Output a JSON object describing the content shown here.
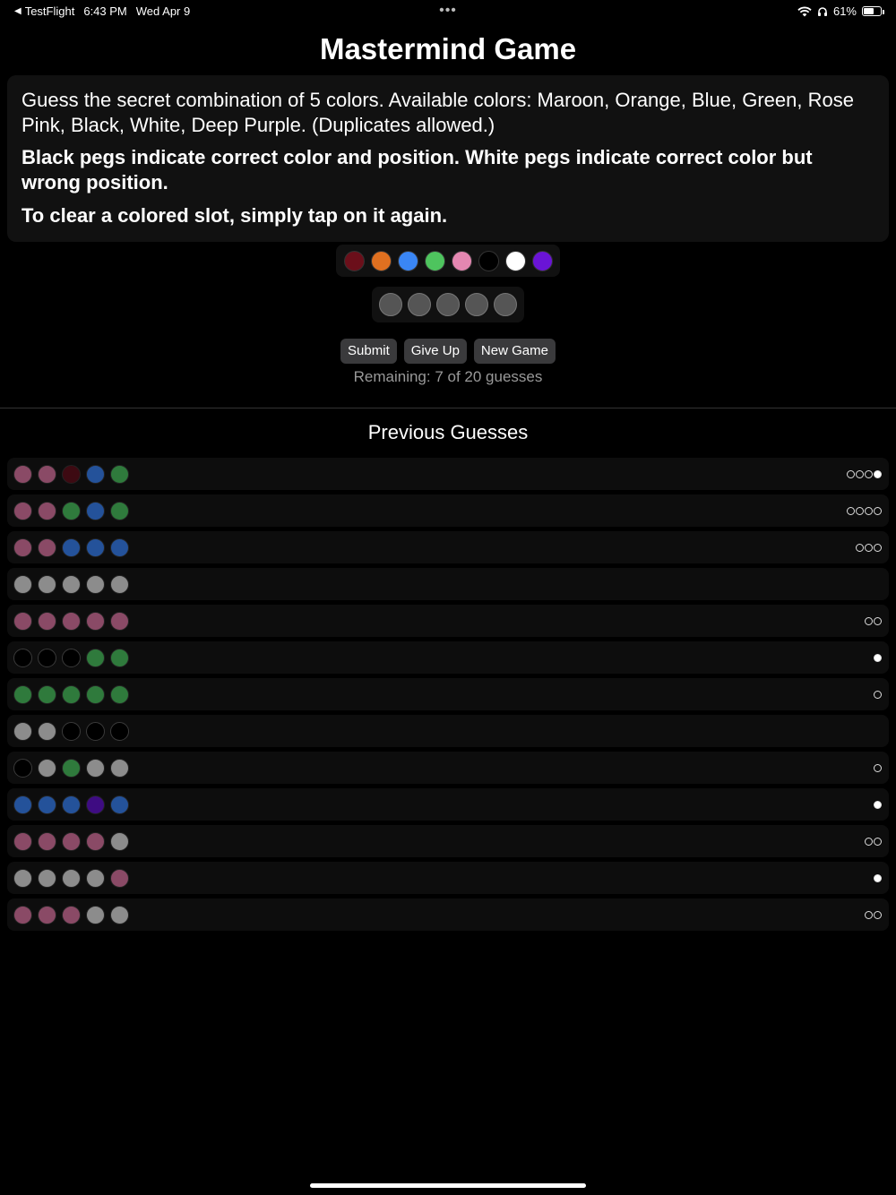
{
  "status_bar": {
    "back_app": "TestFlight",
    "time": "6:43 PM",
    "date": "Wed Apr 9",
    "more": "•••",
    "battery": "61%"
  },
  "title": "Mastermind Game",
  "instructions": {
    "line1": "Guess the secret combination of 5 colors. Available colors: Maroon, Orange, Blue, Green, Rose Pink, Black, White, Deep Purple. (Duplicates allowed.)",
    "line2": "Black pegs indicate correct color and position. White pegs indicate correct color but wrong position.",
    "line3": "To clear a colored slot, simply tap on it again."
  },
  "palette": [
    {
      "name": "Maroon",
      "color": "#6b0f1a"
    },
    {
      "name": "Orange",
      "color": "#e07020"
    },
    {
      "name": "Blue",
      "color": "#3a86f5"
    },
    {
      "name": "Green",
      "color": "#4ec45e"
    },
    {
      "name": "Rose Pink",
      "color": "#e487b1"
    },
    {
      "name": "Black",
      "color": "#000000"
    },
    {
      "name": "White",
      "color": "#ffffff"
    },
    {
      "name": "Deep Purple",
      "color": "#6a14d6"
    }
  ],
  "current_slots": [
    null,
    null,
    null,
    null,
    null
  ],
  "buttons": {
    "submit": "Submit",
    "give_up": "Give Up",
    "new_game": "New Game"
  },
  "remaining": "Remaining: 7 of 20 guesses",
  "previous_title": "Previous Guesses",
  "dim_colors": {
    "rose": "#8a4a66",
    "maroon": "#3d0a12",
    "blue": "#24529a",
    "green": "#2f7a3c",
    "white": "#8c8c8c",
    "black": "#000000",
    "purple": "#3e0c82"
  },
  "guesses": [
    {
      "pegs": [
        "rose",
        "rose",
        "maroon",
        "blue",
        "green"
      ],
      "feedback": [
        "w",
        "w",
        "w",
        "b"
      ]
    },
    {
      "pegs": [
        "rose",
        "rose",
        "green",
        "blue",
        "green"
      ],
      "feedback": [
        "w",
        "w",
        "w",
        "w"
      ]
    },
    {
      "pegs": [
        "rose",
        "rose",
        "blue",
        "blue",
        "blue"
      ],
      "feedback": [
        "w",
        "w",
        "w"
      ]
    },
    {
      "pegs": [
        "white",
        "white",
        "white",
        "white",
        "white"
      ],
      "feedback": []
    },
    {
      "pegs": [
        "rose",
        "rose",
        "rose",
        "rose",
        "rose"
      ],
      "feedback": [
        "w",
        "w"
      ]
    },
    {
      "pegs": [
        "black",
        "black",
        "black",
        "green",
        "green"
      ],
      "feedback": [
        "b"
      ]
    },
    {
      "pegs": [
        "green",
        "green",
        "green",
        "green",
        "green"
      ],
      "feedback": [
        "w"
      ]
    },
    {
      "pegs": [
        "white",
        "white",
        "black",
        "black",
        "black"
      ],
      "feedback": []
    },
    {
      "pegs": [
        "black",
        "white",
        "green",
        "white",
        "white"
      ],
      "feedback": [
        "w"
      ]
    },
    {
      "pegs": [
        "blue",
        "blue",
        "blue",
        "purple",
        "blue"
      ],
      "feedback": [
        "b"
      ]
    },
    {
      "pegs": [
        "rose",
        "rose",
        "rose",
        "rose",
        "white"
      ],
      "feedback": [
        "w",
        "w"
      ]
    },
    {
      "pegs": [
        "white",
        "white",
        "white",
        "white",
        "rose"
      ],
      "feedback": [
        "b"
      ]
    },
    {
      "pegs": [
        "rose",
        "rose",
        "rose",
        "white",
        "white"
      ],
      "feedback": [
        "w",
        "w"
      ]
    }
  ]
}
